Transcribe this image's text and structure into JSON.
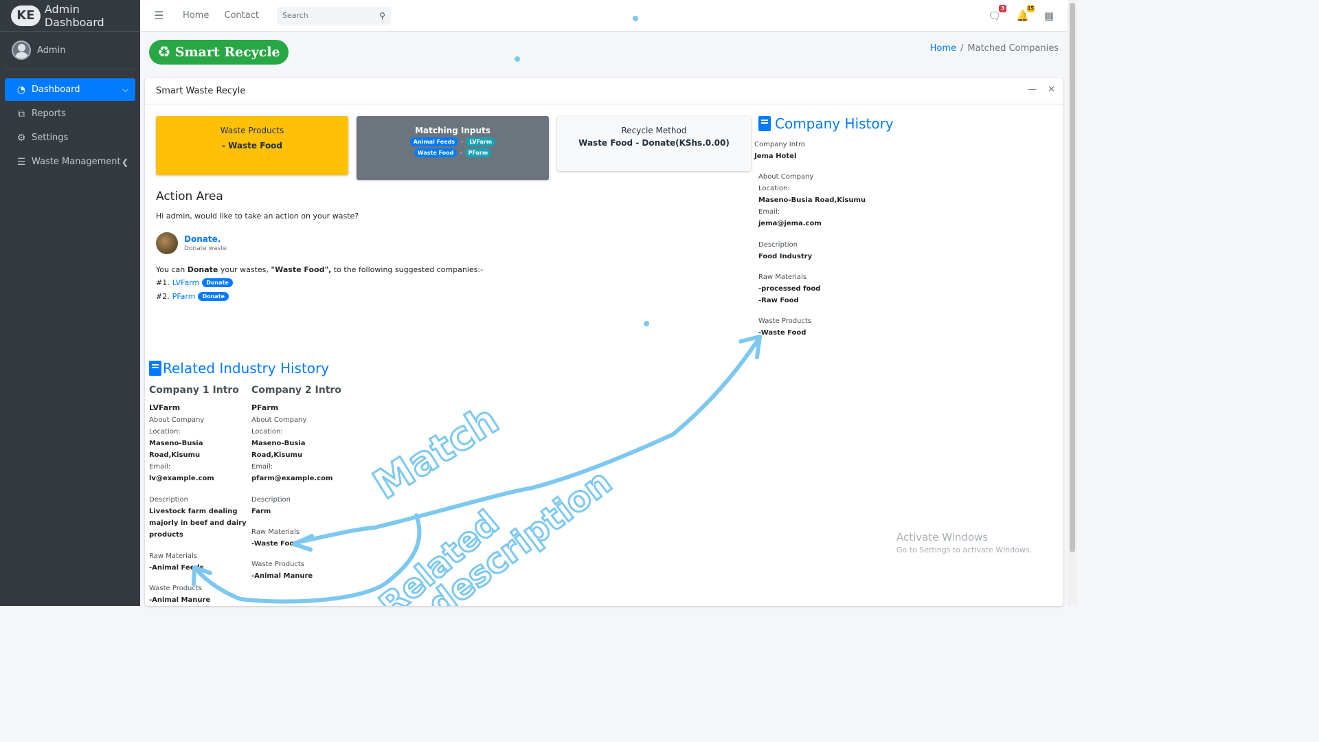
{
  "app": {
    "title": "Admin Dashboard",
    "logo_text": "KE"
  },
  "user": {
    "name": "Admin"
  },
  "sidebar": {
    "items": [
      {
        "label": "Dashboard",
        "icon": "gauge-icon",
        "active": true
      },
      {
        "label": "Reports",
        "icon": "copy-icon"
      },
      {
        "label": "Settings",
        "icon": "gear-icon"
      },
      {
        "label": "Waste Management",
        "icon": "list-icon"
      }
    ]
  },
  "topnav": {
    "links": [
      "Home",
      "Contact"
    ],
    "search_placeholder": "Search",
    "messages_badge": "3",
    "notifications_badge": "15"
  },
  "brand_pill": {
    "text": "Smart Recycle"
  },
  "breadcrumb": {
    "home": "Home",
    "current": "Matched Companies"
  },
  "card": {
    "title": "Smart Waste Recyle",
    "waste_products": {
      "title": "Waste Products",
      "value": "- Waste Food"
    },
    "matching_inputs": {
      "title": "Matching Inputs",
      "rows": [
        {
          "input": "Animal Feeds",
          "company": "LVFarm"
        },
        {
          "input": "Waste Food",
          "company": "PFarm"
        }
      ]
    },
    "recycle_method": {
      "title": "Recycle Method",
      "value": "Waste Food - Donate(KShs.0.00)"
    },
    "action": {
      "title": "Action Area",
      "prompt": "Hi admin, would like to take an action on your waste?",
      "donate_label": "Donate.",
      "donate_sub": "Donate waste",
      "suggest_pre": "You can ",
      "suggest_action": "Donate",
      "suggest_mid": " your wastes, ",
      "suggest_waste": "\"Waste Food\",",
      "suggest_post": " to the following suggested companies:-",
      "suggestions": [
        {
          "num": "#1.",
          "name": "LVFarm",
          "button": "Donate"
        },
        {
          "num": "#2.",
          "name": "PFarm",
          "button": "Donate"
        }
      ]
    }
  },
  "company_history": {
    "heading": "Company History",
    "intro_label": "Company Intro",
    "intro_value": "Jema Hotel",
    "about_label": "About Company",
    "location_label": "Location:",
    "location_value": "Maseno-Busia Road,Kisumu",
    "email_label": "Email:",
    "email_value": "jema@jema.com",
    "description_label": "Description",
    "description_value": "Food Industry",
    "raw_label": "Raw Materials",
    "raw_values": [
      "-processed food",
      "-Raw Food"
    ],
    "waste_label": "Waste Products",
    "waste_values": [
      "-Waste Food"
    ]
  },
  "related": {
    "heading": "Related Industry History",
    "companies": [
      {
        "intro_heading": "Company 1 Intro",
        "name": "LVFarm",
        "about_label": "About Company",
        "location_label": "Location:",
        "location_line1": "Maseno-Busia",
        "location_line2": "Road,Kisumu",
        "email_label": "Email:",
        "email_value": "lv@example.com",
        "description_label": "Description",
        "description_lines": [
          "Livestock farm dealing",
          "majorly in beef and dairy",
          "products"
        ],
        "raw_label": "Raw Materials",
        "raw_values": [
          "-Animal Feeds"
        ],
        "waste_label": "Waste Products",
        "waste_values": [
          "-Animal Manure"
        ]
      },
      {
        "intro_heading": "Company 2 Intro",
        "name": "PFarm",
        "about_label": "About Company",
        "location_label": "Location:",
        "location_line1": "Maseno-Busia",
        "location_line2": "Road,Kisumu",
        "email_label": "Email:",
        "email_value": "pfarm@example.com",
        "description_label": "Description",
        "description_lines": [
          "Farm"
        ],
        "raw_label": "Raw Materials",
        "raw_values": [
          "-Waste Food"
        ],
        "waste_label": "Waste Products",
        "waste_values": [
          "-Animal Manure"
        ]
      }
    ]
  },
  "annotations": {
    "match": "Match",
    "related": "Related",
    "description": "description",
    "color": "#7cc8f0"
  },
  "watermark": {
    "title": "Activate Windows",
    "subtitle": "Go to Settings to activate Windows."
  },
  "colors": {
    "sidebar": "#343a40",
    "primary": "#007bff",
    "success": "#28a745",
    "warning": "#ffc107",
    "secondary": "#6c757d",
    "info": "#17a2b8"
  }
}
